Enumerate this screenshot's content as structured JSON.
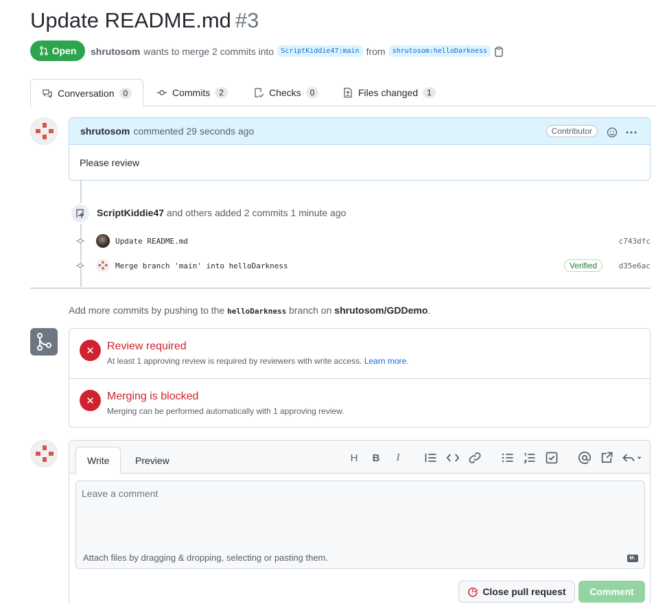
{
  "pr": {
    "title": "Update README.md",
    "number": "#3",
    "state_label": "Open",
    "author": "shrutosom",
    "meta_text": "wants to merge 2 commits into",
    "base_branch": "ScriptKiddie47:main",
    "from_text": "from",
    "head_branch": "shrutosom:helloDarkness"
  },
  "tabs": [
    {
      "label": "Conversation",
      "count": "0"
    },
    {
      "label": "Commits",
      "count": "2"
    },
    {
      "label": "Checks",
      "count": "0"
    },
    {
      "label": "Files changed",
      "count": "1"
    }
  ],
  "comment": {
    "author": "shrutosom",
    "when": "commented 29 seconds ago",
    "role": "Contributor",
    "body": "Please review"
  },
  "commit_event": {
    "actor": "ScriptKiddie47",
    "text": "and others added 2 commits 1 minute ago"
  },
  "commits": [
    {
      "message": "Update README.md",
      "sha": "c743dfc",
      "verified": ""
    },
    {
      "message": "Merge branch 'main' into helloDarkness",
      "sha": "d35e6ac",
      "verified": "Verified"
    }
  ],
  "push_hint": {
    "prefix": "Add more commits by pushing to the",
    "branch": "helloDarkness",
    "middle": "branch on",
    "repo": "shrutosom/GDDemo",
    "suffix": "."
  },
  "merge_checks": [
    {
      "title": "Review required",
      "desc": "At least 1 approving review is required by reviewers with write access.",
      "link": "Learn more."
    },
    {
      "title": "Merging is blocked",
      "desc": "Merging can be performed automatically with 1 approving review.",
      "link": ""
    }
  ],
  "editor": {
    "tab_write": "Write",
    "tab_preview": "Preview",
    "placeholder": "Leave a comment",
    "attach_hint": "Attach files by dragging & dropping, selecting or pasting them.",
    "markdown_badge": "M↓",
    "close_label": "Close pull request",
    "comment_label": "Comment",
    "toolbar": {
      "heading": "H",
      "bold": "B",
      "italic": "I"
    }
  },
  "colors": {
    "open_green": "#2da44e",
    "error_red": "#cf222e",
    "link_blue": "#0969da",
    "comment_disabled": "#94d3a2"
  }
}
